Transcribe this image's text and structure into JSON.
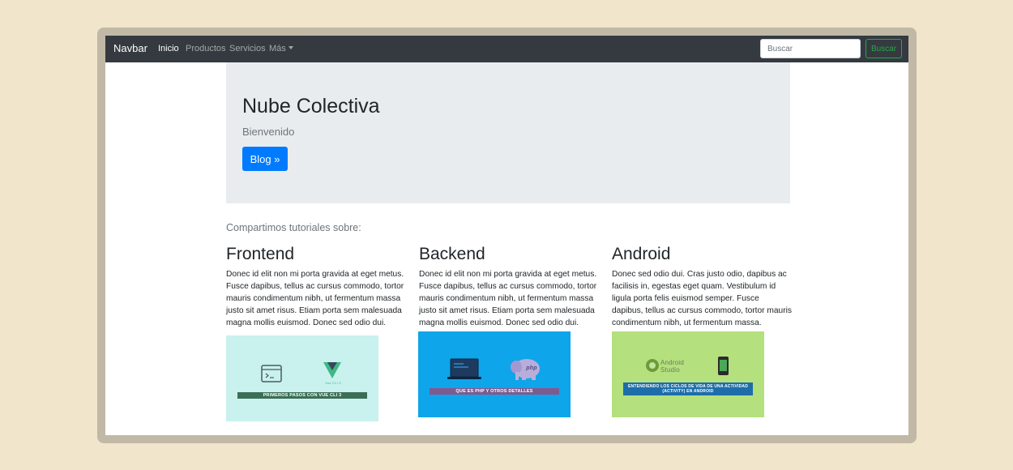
{
  "navbar": {
    "brand": "Navbar",
    "links": [
      {
        "label": "Inicio",
        "active": true
      },
      {
        "label": "Productos",
        "active": false
      },
      {
        "label": "Servicios",
        "active": false
      },
      {
        "label": "Más",
        "active": false,
        "dropdown": true
      }
    ],
    "search_placeholder": "Buscar",
    "search_button": "Buscar"
  },
  "jumbotron": {
    "title": "Nube Colectiva",
    "subtitle": "Bienvenido",
    "button": "Blog »"
  },
  "lead": "Compartimos tutoriales sobre:",
  "columns": [
    {
      "heading": "Frontend",
      "text": "Donec id elit non mi porta gravida at eget metus. Fusce dapibus, tellus ac cursus commodo, tortor mauris condimentum nibh, ut fermentum massa justo sit amet risus. Etiam porta sem malesuada magna mollis euismod. Donec sed odio dui.",
      "thumbnail": {
        "banner": "PRIMEROS PASOS CON VUE CLI 3",
        "logo_text": "Vue CLI 3",
        "bg": "#c9f1ee"
      }
    },
    {
      "heading": "Backend",
      "text": "Donec id elit non mi porta gravida at eget metus. Fusce dapibus, tellus ac cursus commodo, tortor mauris condimentum nibh, ut fermentum massa justo sit amet risus. Etiam porta sem malesuada magna mollis euismod. Donec sed odio dui.",
      "thumbnail": {
        "banner": "QUE ES PHP Y OTROS DETALLES",
        "logo_text": "php",
        "bg": "#0ea5ea"
      }
    },
    {
      "heading": "Android",
      "text": "Donec sed odio dui. Cras justo odio, dapibus ac facilisis in, egestas eget quam. Vestibulum id ligula porta felis euismod semper. Fusce dapibus, tellus ac cursus commodo, tortor mauris condimentum nibh, ut fermentum massa.",
      "thumbnail": {
        "banner": "ENTENDIENDO LOS CICLOS DE VIDA DE UNA ACTIVIDAD (ACTIVITY) EN ANDROID",
        "logo_text": "Android Studio",
        "bg": "#b5e07e"
      }
    }
  ]
}
